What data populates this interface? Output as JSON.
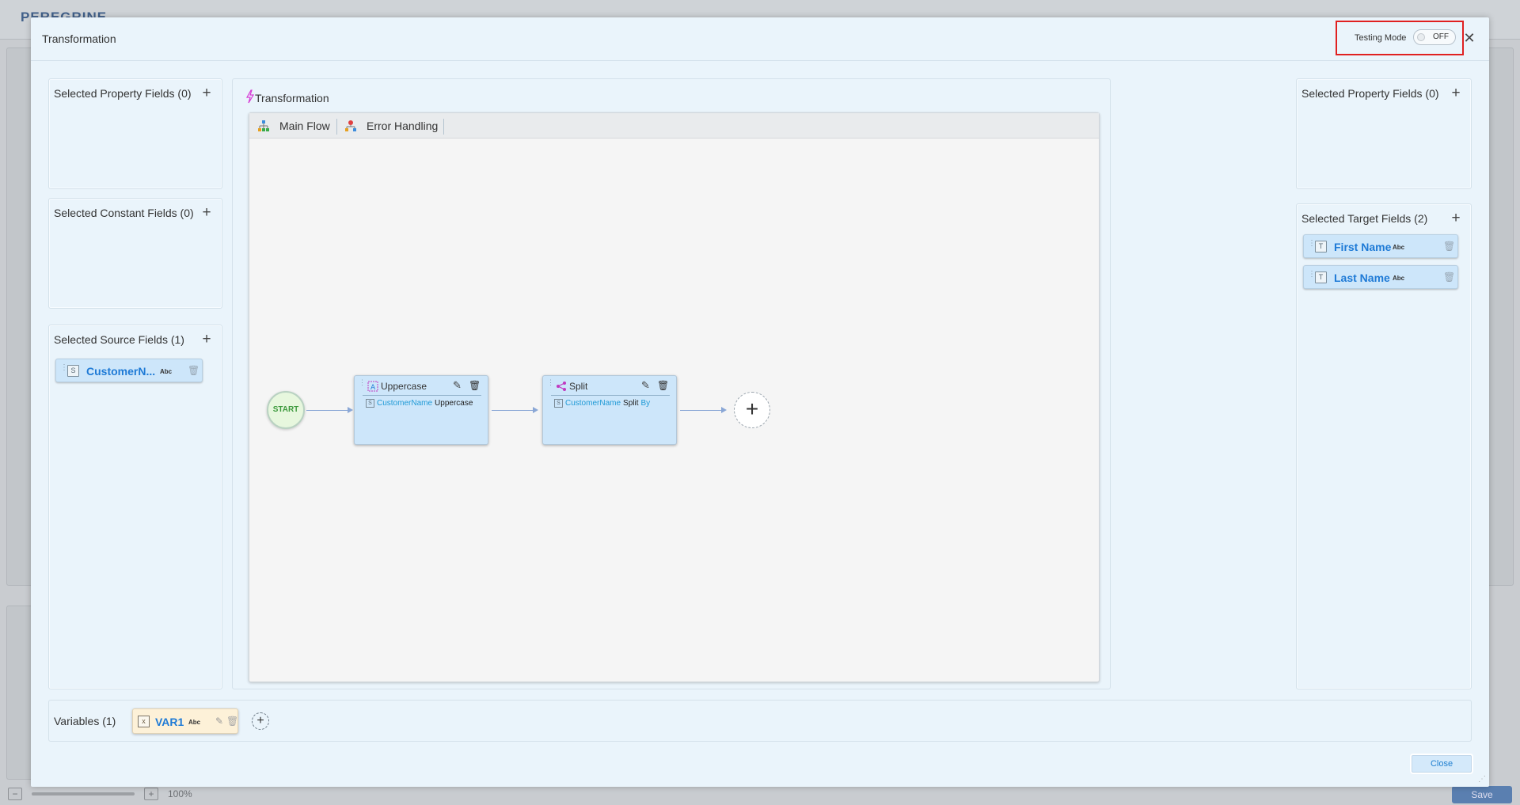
{
  "background": {
    "logo": "PEREGRINE",
    "zoom_level": "100%",
    "save_label": "Save"
  },
  "modal": {
    "title": "Transformation",
    "testing_mode_label": "Testing Mode",
    "testing_mode_state": "OFF",
    "close_label": "Close"
  },
  "left": {
    "property": {
      "title": "Selected Property Fields (0)"
    },
    "constant": {
      "title": "Selected Constant Fields (0)"
    },
    "source": {
      "title": "Selected Source Fields (1)",
      "fields": [
        {
          "name": "CustomerN...",
          "type": "Abc"
        }
      ]
    }
  },
  "right": {
    "property": {
      "title": "Selected Property Fields (0)"
    },
    "target": {
      "title": "Selected Target Fields (2)",
      "fields": [
        {
          "name": "First Name",
          "type": "Abc"
        },
        {
          "name": "Last Name",
          "type": "Abc"
        }
      ]
    }
  },
  "center": {
    "title": "Transformation",
    "tabs": [
      {
        "label": "Main Flow"
      },
      {
        "label": "Error Handling"
      }
    ],
    "start_label": "START",
    "nodes": [
      {
        "title": "Uppercase",
        "field": "CustomerName",
        "op": "Uppercase",
        "kw": ""
      },
      {
        "title": "Split",
        "field": "CustomerName",
        "op": "Split",
        "kw": "By"
      }
    ]
  },
  "variables": {
    "title": "Variables (1)",
    "items": [
      {
        "name": "VAR1",
        "type": "Abc"
      }
    ]
  },
  "colors": {
    "accent": "#1e7ad6",
    "highlight_border": "#e02020",
    "chip_bg": "#cde6fa",
    "variable_bg": "#fdf1d8"
  }
}
